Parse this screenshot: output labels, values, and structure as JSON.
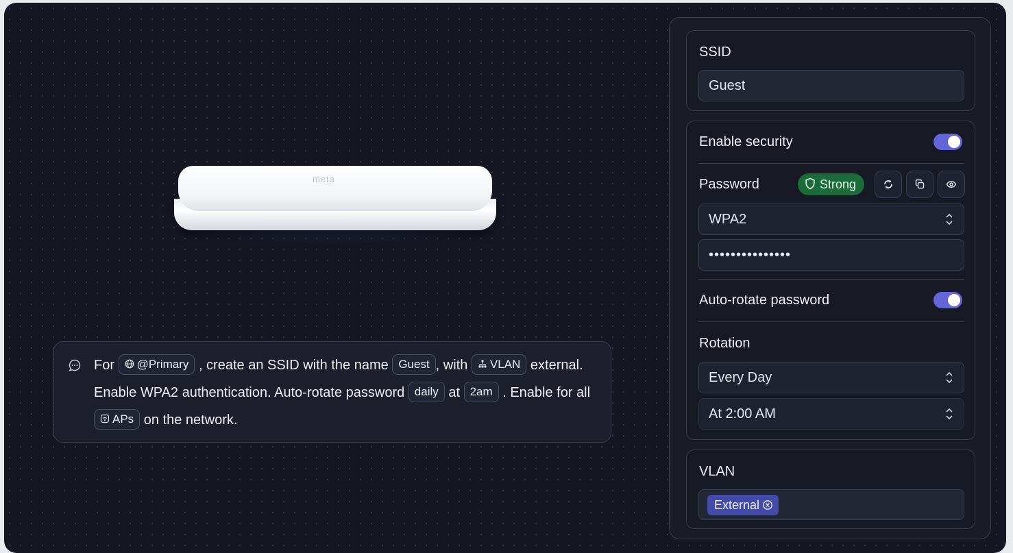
{
  "device": {
    "logo_text": "meta"
  },
  "prompt": {
    "t1": "For",
    "chip_primary": "@Primary",
    "t2": ", create an SSID with the name",
    "chip_guest": "Guest",
    "t3": ", with",
    "chip_vlan": "VLAN",
    "t4": "external. Enable WPA2 authentication. Auto-rotate password",
    "chip_daily": "daily",
    "t5": "at",
    "chip_2am": "2am",
    "t6": ". Enable for all",
    "chip_aps": "APs",
    "t7": "on the network."
  },
  "ssid": {
    "label": "SSID",
    "value": "Guest"
  },
  "security": {
    "enable_label": "Enable security",
    "enabled": true,
    "password_label": "Password",
    "strength_badge": "Strong",
    "auth_value": "WPA2",
    "password_mask": "•••••••••••••••",
    "auto_rotate_label": "Auto-rotate password",
    "auto_rotate_enabled": true,
    "rotation_label": "Rotation",
    "rotation_value": "Every Day",
    "time_prefix": "At",
    "time_value": "2:00 AM"
  },
  "vlan": {
    "label": "VLAN",
    "tag": "External"
  },
  "colors": {
    "accent": "#6366d9",
    "strong_badge": "#1c6b3a",
    "tag": "#444aa8"
  }
}
